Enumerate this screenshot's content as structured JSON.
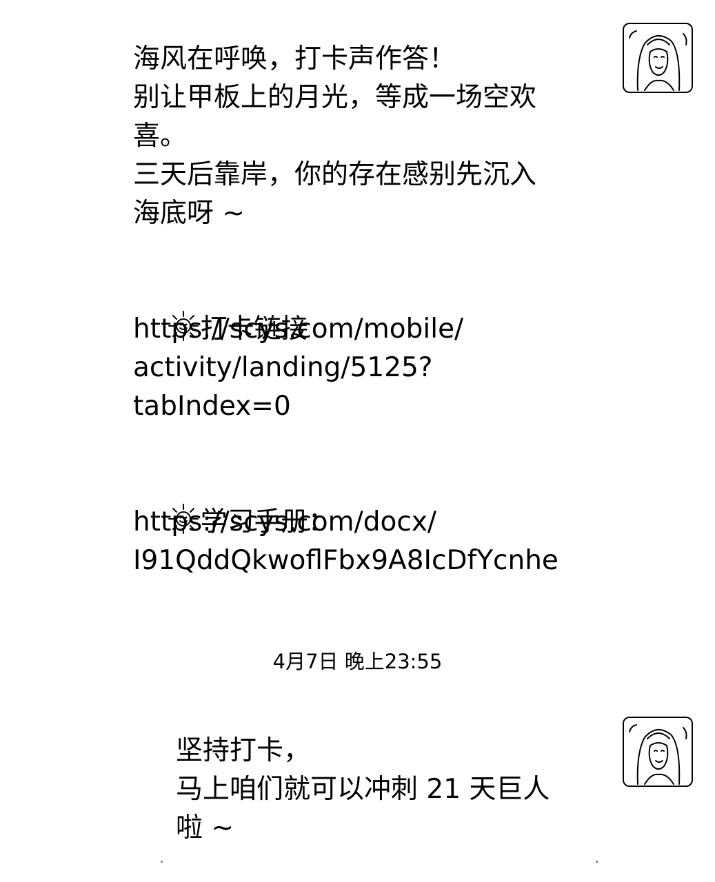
{
  "messages": [
    {
      "lines": [
        "海风在呼唤，打卡声作答！",
        "别让甲板上的月光，等成一场空欢",
        "喜。",
        "三天后靠岸，你的存在感别先沉入",
        "海底呀 ~"
      ],
      "checkin": {
        "icon": "sun-icon",
        "label": "打卡链接",
        "url_lines": [
          "https://scys.com/mobile/",
          "activity/landing/5125?",
          "tabIndex=0"
        ]
      },
      "handbook": {
        "icon": "sun-icon",
        "label": "学习手册：",
        "url_lines": [
          "https://scys.com/docx/",
          "I91QddQkwoflFbx9A8IcDfYcnhe"
        ]
      }
    },
    {
      "lines": [
        "坚持打卡，",
        "马上咱们就可以冲刺 21 天巨人",
        "啦 ~"
      ]
    }
  ],
  "timestamp": "4月7日 晚上23:55",
  "avatar_icon": "avatar-sketch-icon"
}
